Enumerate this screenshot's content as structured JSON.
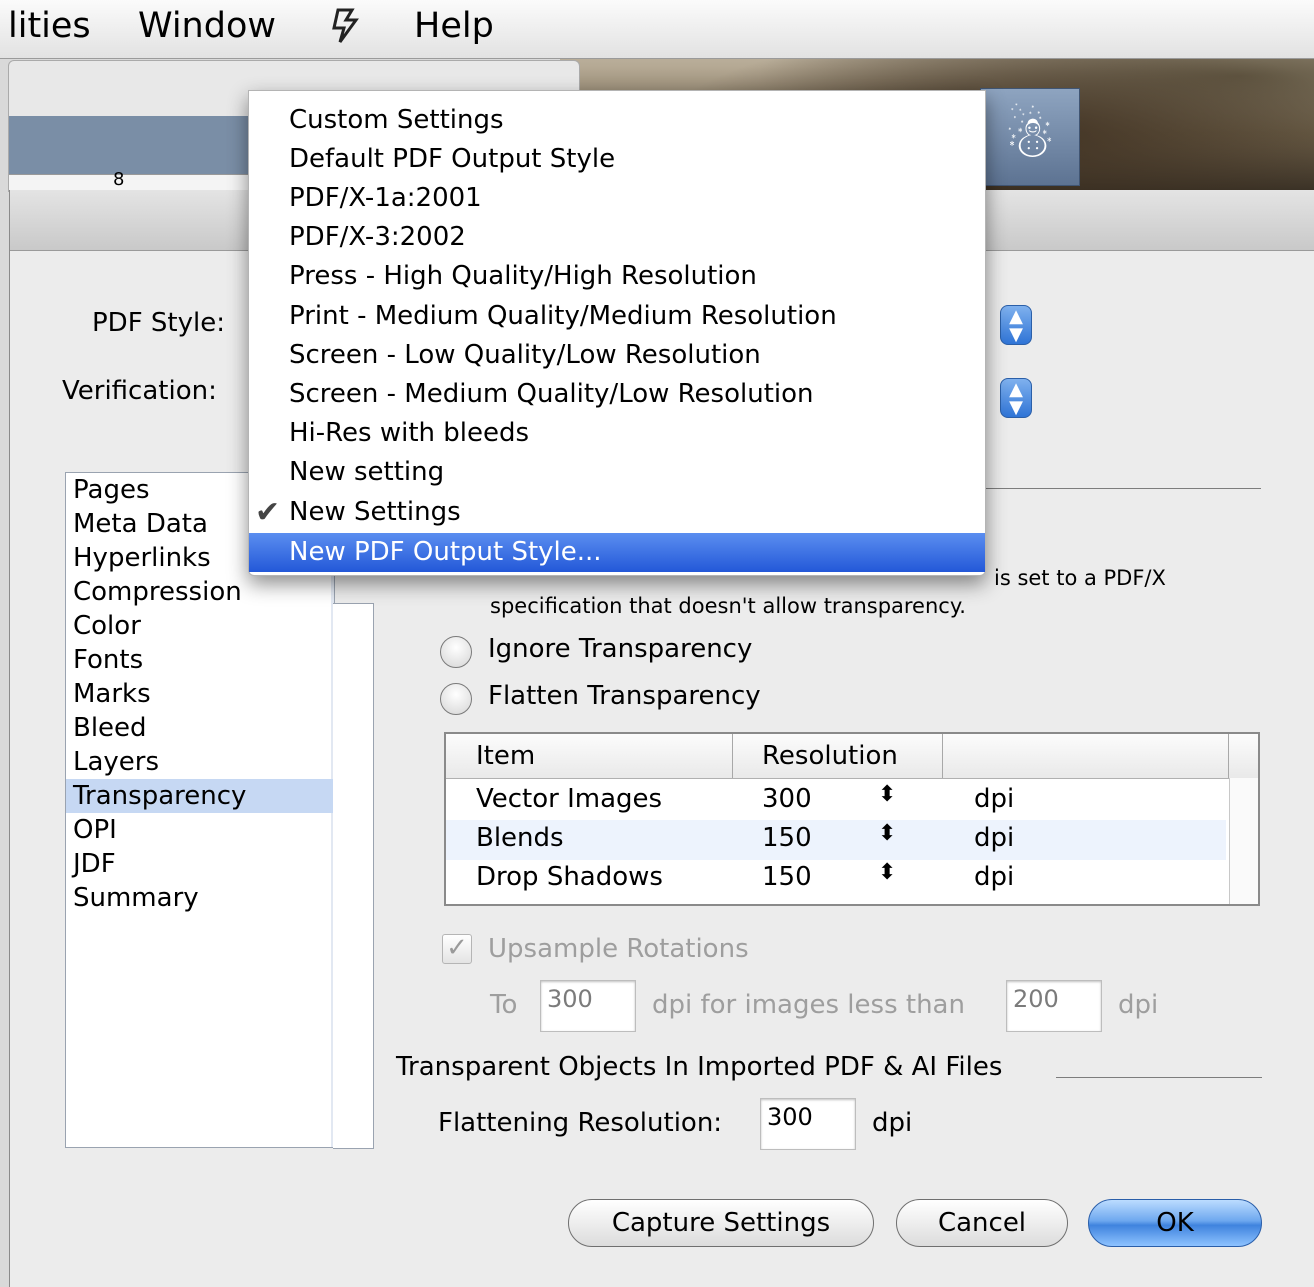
{
  "menubar": {
    "items": [
      "lities",
      "Window",
      "Help"
    ],
    "script_icon": "script-menu-icon"
  },
  "background_window": {
    "ruler_mark": "8"
  },
  "dialog": {
    "pdf_style_label": "PDF Style:",
    "verification_label": "Verification:",
    "sidebar": {
      "items": [
        "Pages",
        "Meta Data",
        "Hyperlinks",
        "Compression",
        "Color",
        "Fonts",
        "Marks",
        "Bleed",
        "Layers",
        "Transparency",
        "OPI",
        "JDF",
        "Summary"
      ],
      "selected": "Transparency"
    },
    "note_line1": "is set to a PDF/X",
    "note_line2": "specification that doesn't allow transparency.",
    "radio_ignore": "Ignore Transparency",
    "radio_flatten": "Flatten Transparency",
    "table": {
      "headers": [
        "Item",
        "Resolution",
        ""
      ],
      "rows": [
        {
          "item": "Vector Images",
          "resolution": "300",
          "unit": "dpi"
        },
        {
          "item": "Blends",
          "resolution": "150",
          "unit": "dpi"
        },
        {
          "item": "Drop Shadows",
          "resolution": "150",
          "unit": "dpi"
        }
      ]
    },
    "upsample_label": "Upsample Rotations",
    "upsample_checked": true,
    "to_label": "To",
    "to_value": "300",
    "dpi_less_label": "dpi for images less than",
    "less_than_value": "200",
    "dpi_label": "dpi",
    "section_title": "Transparent Objects In Imported PDF & AI Files",
    "flattening_label": "Flattening Resolution:",
    "flattening_value": "300",
    "flattening_unit": "dpi",
    "buttons": {
      "capture": "Capture Settings",
      "cancel": "Cancel",
      "ok": "OK"
    }
  },
  "dropdown": {
    "items": [
      "Custom Settings",
      "Default PDF Output Style",
      "PDF/X-1a:2001",
      "PDF/X-3:2002",
      "Press - High Quality/High Resolution",
      "Print - Medium Quality/Medium Resolution",
      "Screen - Low Quality/Low Resolution",
      "Screen - Medium Quality/Low Resolution",
      "Hi-Res with bleeds",
      "New setting",
      "New Settings",
      "New PDF Output Style..."
    ],
    "checked": "New Settings",
    "highlighted": "New PDF Output Style..."
  }
}
